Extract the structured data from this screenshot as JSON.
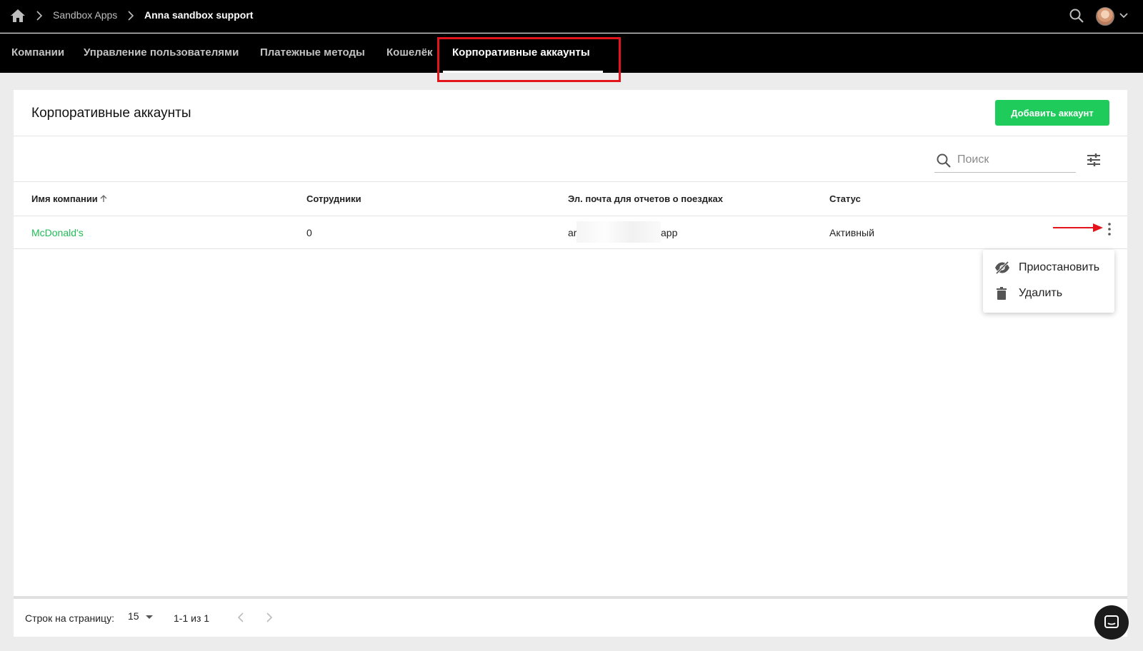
{
  "breadcrumb": {
    "items": [
      "Sandbox Apps",
      "Anna sandbox support"
    ]
  },
  "nav": {
    "tabs": [
      {
        "label": "Компании"
      },
      {
        "label": "Управление пользователями"
      },
      {
        "label": "Платежные методы"
      },
      {
        "label": "Кошелёк"
      },
      {
        "label": "Корпоративные аккаунты",
        "active": true
      }
    ]
  },
  "page": {
    "title": "Корпоративные аккаунты",
    "add_button": "Добавить аккаунт"
  },
  "search": {
    "placeholder": "Поиск"
  },
  "table": {
    "headers": [
      "Имя компании",
      "Сотрудники",
      "Эл. почта для отчетов о поездках",
      "Статус"
    ],
    "rows": [
      {
        "company": "McDonald's",
        "employees": "0",
        "email_start": "ar",
        "email_end": "app",
        "status": "Активный"
      }
    ]
  },
  "menu": {
    "items": [
      {
        "label": "Приостановить",
        "icon": "eye-off-icon"
      },
      {
        "label": "Удалить",
        "icon": "trash-icon"
      }
    ]
  },
  "footer": {
    "rows_per_page_label": "Строк на страницу:",
    "rows_per_page_value": "15",
    "range": "1-1 из 1"
  },
  "colors": {
    "accent": "#1fcb5b",
    "highlight": "#e3141b",
    "topbar": "#000000"
  }
}
